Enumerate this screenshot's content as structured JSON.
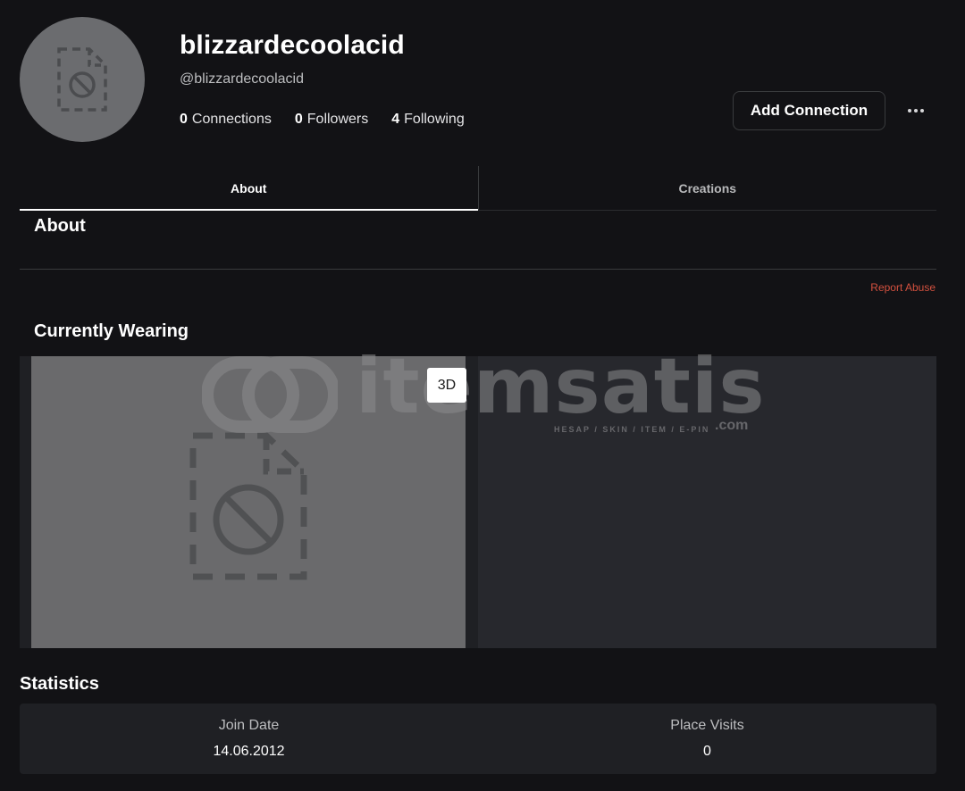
{
  "profile": {
    "display_name": "blizzardecoolacid",
    "handle": "@blizzardecoolacid",
    "avatar_icon": "broken-image-icon",
    "connections_count": "0",
    "connections_label": "Connections",
    "followers_count": "0",
    "followers_label": "Followers",
    "following_count": "4",
    "following_label": "Following"
  },
  "actions": {
    "add_connection_label": "Add Connection",
    "more_icon": "more-horizontal-icon"
  },
  "tabs": [
    {
      "label": "About",
      "active": true
    },
    {
      "label": "Creations",
      "active": false
    }
  ],
  "about": {
    "title": "About",
    "report_label": "Report Abuse"
  },
  "wearing": {
    "title": "Currently Wearing",
    "toggle_3d_label": "3D",
    "placeholder_icon": "broken-image-icon"
  },
  "watermark": {
    "brand": "itemsatis",
    "tagline": "HESAP / SKIN / ITEM / E-PIN",
    "suffix": ".com"
  },
  "statistics": {
    "title": "Statistics",
    "items": [
      {
        "label": "Join Date",
        "value": "14.06.2012"
      },
      {
        "label": "Place Visits",
        "value": "0"
      }
    ]
  },
  "colors": {
    "background": "#121215",
    "panel": "#1f2024",
    "report_link": "#d4513f",
    "avatar_bg": "#6b6c6f"
  }
}
